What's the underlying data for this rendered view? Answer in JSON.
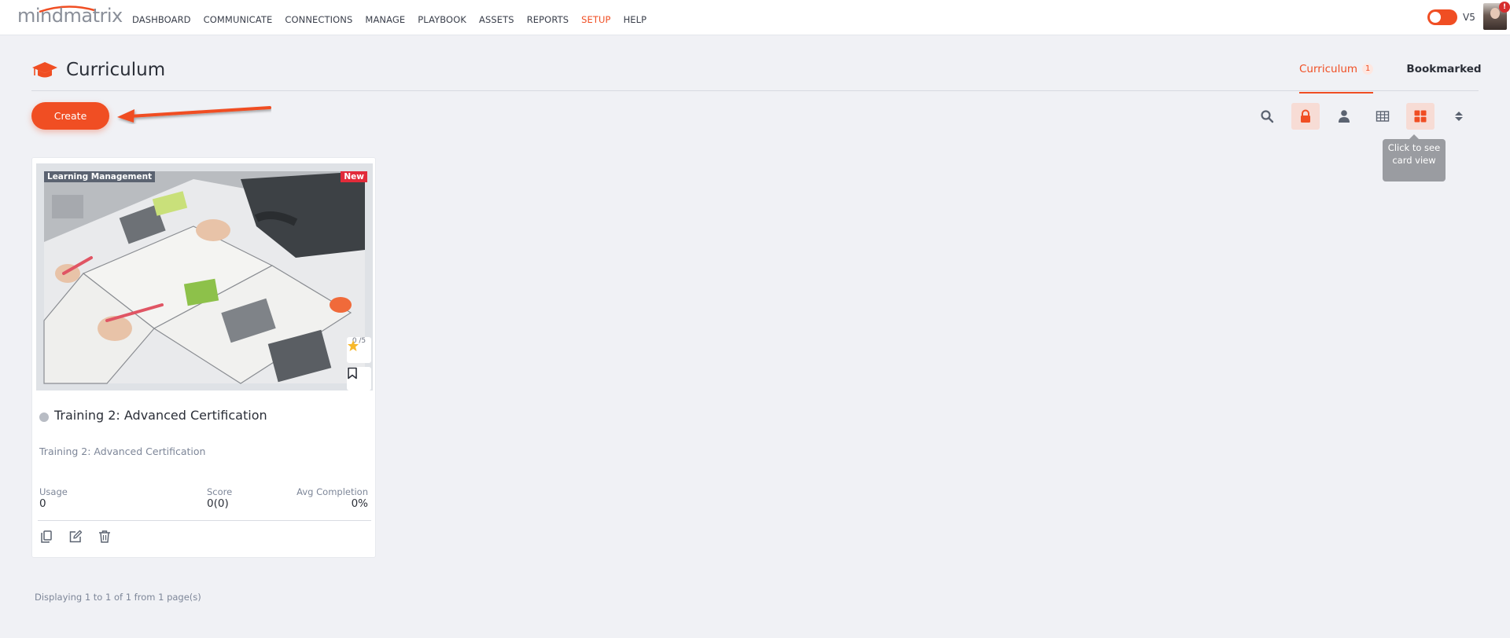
{
  "brand": {
    "logo_text": "mindmatrix",
    "accent": "#f04e23"
  },
  "nav": {
    "items": [
      {
        "label": "DASHBOARD"
      },
      {
        "label": "COMMUNICATE"
      },
      {
        "label": "CONNECTIONS"
      },
      {
        "label": "MANAGE"
      },
      {
        "label": "PLAYBOOK"
      },
      {
        "label": "ASSETS"
      },
      {
        "label": "REPORTS"
      },
      {
        "label": "SETUP",
        "active": true
      },
      {
        "label": "HELP"
      }
    ],
    "version_label": "V5",
    "notification_count": "!"
  },
  "page": {
    "title": "Curriculum",
    "tabs": [
      {
        "label": "Curriculum",
        "count": "1",
        "active": true
      },
      {
        "label": "Bookmarked"
      }
    ]
  },
  "toolbar": {
    "create_label": "Create",
    "tools": [
      "search-icon",
      "lock-icon",
      "user-icon",
      "table-view-icon",
      "card-view-icon",
      "sort-icon"
    ],
    "tooltip": "Click to see card view"
  },
  "card": {
    "category": "Learning Management",
    "new_badge": "New",
    "rating": "0 /5",
    "title": "Training 2: Advanced Certification",
    "description": "Training 2: Advanced Certification",
    "stats": {
      "usage_label": "Usage",
      "usage_value": "0",
      "score_label": "Score",
      "score_value": "0(0)",
      "completion_label": "Avg Completion",
      "completion_value": "0%"
    },
    "actions": [
      "copy-icon",
      "edit-icon",
      "delete-icon"
    ]
  },
  "footer": {
    "pagination": "Displaying 1 to 1 of 1 from 1 page(s)"
  }
}
